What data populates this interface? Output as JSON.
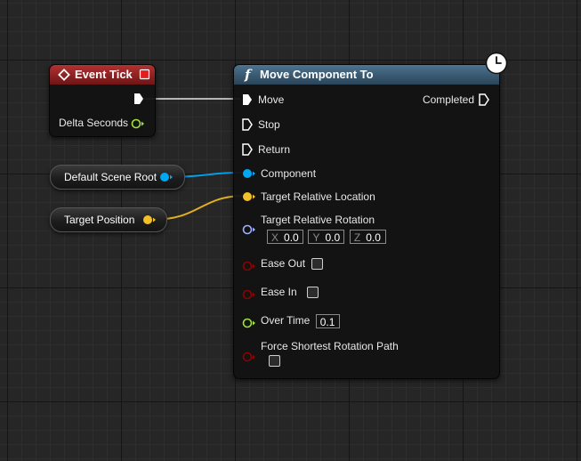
{
  "event_tick": {
    "title": "Event Tick",
    "exec_out_label": "",
    "delta_seconds_label": "Delta Seconds"
  },
  "var_nodes": {
    "default_scene_root": "Default Scene Root",
    "target_position": "Target Position"
  },
  "move_node": {
    "title": "Move Component To",
    "function_glyph": "f",
    "pins": {
      "move": "Move",
      "stop": "Stop",
      "return": "Return",
      "completed": "Completed",
      "component": "Component",
      "target_relative_location": "Target Relative Location",
      "target_relative_rotation": "Target Relative Rotation",
      "ease_out": "Ease Out",
      "ease_in": "Ease In",
      "over_time": "Over Time",
      "force_shortest_rotation_path": "Force Shortest Rotation Path"
    },
    "rotation": {
      "x_axis": "X",
      "x_value": "0.0",
      "y_axis": "Y",
      "y_value": "0.0",
      "z_axis": "Z",
      "z_value": "0.0"
    },
    "over_time_value": "0.1"
  },
  "colors": {
    "exec": "#ffffff",
    "object_pin": "#00a8f2",
    "vector_pin": "#f3c02a",
    "rotator_pin": "#9cb2ff",
    "bool_pin": "#8f0000",
    "float_pin": "#9ee33f",
    "event_header": "#a32525",
    "func_header": "#3f6783",
    "event_close": "#e02020"
  }
}
